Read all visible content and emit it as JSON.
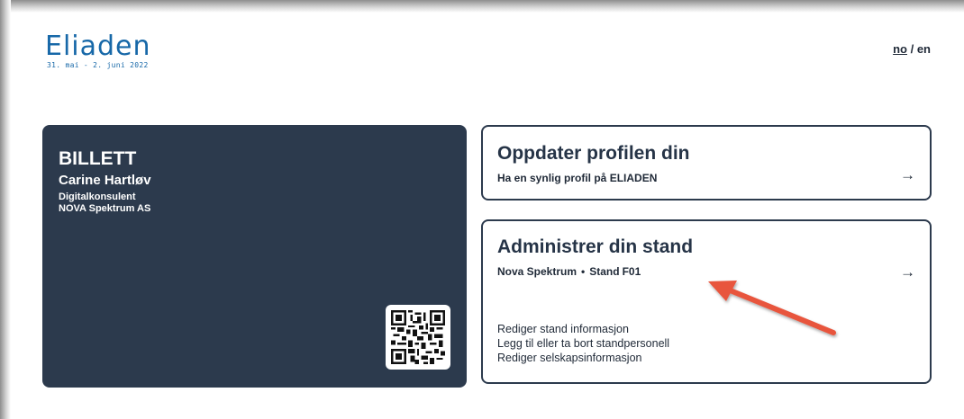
{
  "header": {
    "logo_text": "Eliaden",
    "logo_dates": "31. mai - 2. juni 2022",
    "lang_active": "no",
    "lang_separator": " / ",
    "lang_other": "en"
  },
  "ticket": {
    "title": "BILLETT",
    "name": "Carine Hartløv",
    "role": "Digitalkonsulent",
    "company": "NOVA Spektrum AS",
    "background": "#2c3a4d"
  },
  "profile_card": {
    "title": "Oppdater profilen din",
    "subtitle": "Ha en synlig profil på ELIADEN",
    "arrow": "→"
  },
  "stand_card": {
    "title": "Administrer din stand",
    "company": "Nova Spektrum",
    "dot": "•",
    "stand_label": "Stand",
    "stand_code": "F01",
    "arrow": "→",
    "links": [
      "Rediger stand informasjon",
      "Legg til eller ta bort standpersonell",
      "Rediger selskapsinformasjon"
    ]
  },
  "colors": {
    "brand": "#1768a8",
    "dark": "#2c3a4d",
    "annotation_arrow": "#e8553e"
  },
  "icons": {
    "qr": "qr-code-icon",
    "arrow": "arrow-right-icon",
    "annotation": "callout-arrow-icon"
  }
}
